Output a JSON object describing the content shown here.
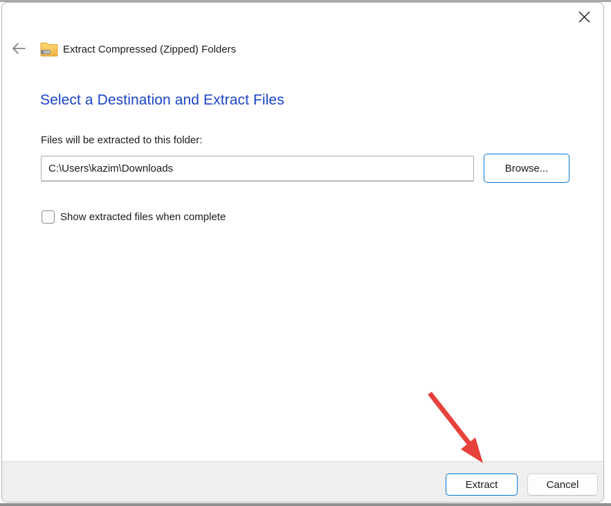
{
  "window": {
    "title": "Extract Compressed (Zipped) Folders",
    "heading": "Select a Destination and Extract Files",
    "colors": {
      "heading_blue": "#1a44c8",
      "accent_border": "#0078d4",
      "annotation_red": "#e6413a",
      "footer_gray": "#efefef"
    },
    "icons": {
      "close": "close-icon",
      "back": "back-arrow-icon",
      "zipped_folder": "zipped-folder-icon",
      "annotation": "red-arrow-annotation"
    }
  },
  "form": {
    "destination_label": "Files will be extracted to this folder:",
    "destination_value": "C:\\Users\\kazim\\Downloads",
    "browse_label": "Browse...",
    "checkbox_label": "Show extracted files when complete",
    "checkbox_checked": false
  },
  "footer": {
    "extract_label": "Extract",
    "cancel_label": "Cancel"
  }
}
